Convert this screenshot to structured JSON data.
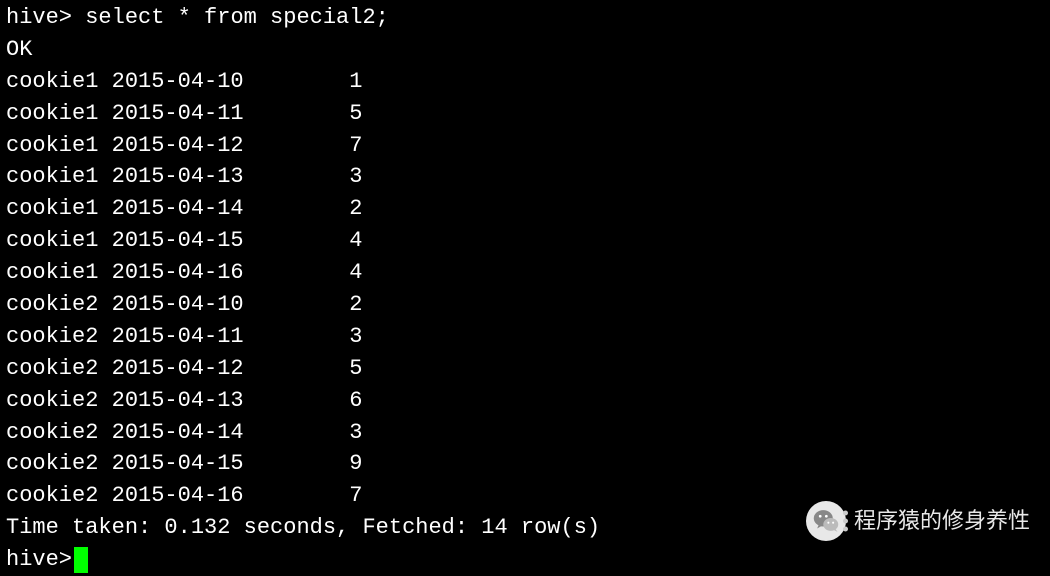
{
  "prompt": "hive>",
  "query": "select * from special2;",
  "ok_line": "OK",
  "rows": [
    {
      "c1": "cookie1",
      "c2": "2015-04-10",
      "c3": "1"
    },
    {
      "c1": "cookie1",
      "c2": "2015-04-11",
      "c3": "5"
    },
    {
      "c1": "cookie1",
      "c2": "2015-04-12",
      "c3": "7"
    },
    {
      "c1": "cookie1",
      "c2": "2015-04-13",
      "c3": "3"
    },
    {
      "c1": "cookie1",
      "c2": "2015-04-14",
      "c3": "2"
    },
    {
      "c1": "cookie1",
      "c2": "2015-04-15",
      "c3": "4"
    },
    {
      "c1": "cookie1",
      "c2": "2015-04-16",
      "c3": "4"
    },
    {
      "c1": "cookie2",
      "c2": "2015-04-10",
      "c3": "2"
    },
    {
      "c1": "cookie2",
      "c2": "2015-04-11",
      "c3": "3"
    },
    {
      "c1": "cookie2",
      "c2": "2015-04-12",
      "c3": "5"
    },
    {
      "c1": "cookie2",
      "c2": "2015-04-13",
      "c3": "6"
    },
    {
      "c1": "cookie2",
      "c2": "2015-04-14",
      "c3": "3"
    },
    {
      "c1": "cookie2",
      "c2": "2015-04-15",
      "c3": "9"
    },
    {
      "c1": "cookie2",
      "c2": "2015-04-16",
      "c3": "7"
    }
  ],
  "footer": "Time taken: 0.132 seconds, Fetched: 14 row(s)",
  "watermark_text": "程序猿的修身养性"
}
